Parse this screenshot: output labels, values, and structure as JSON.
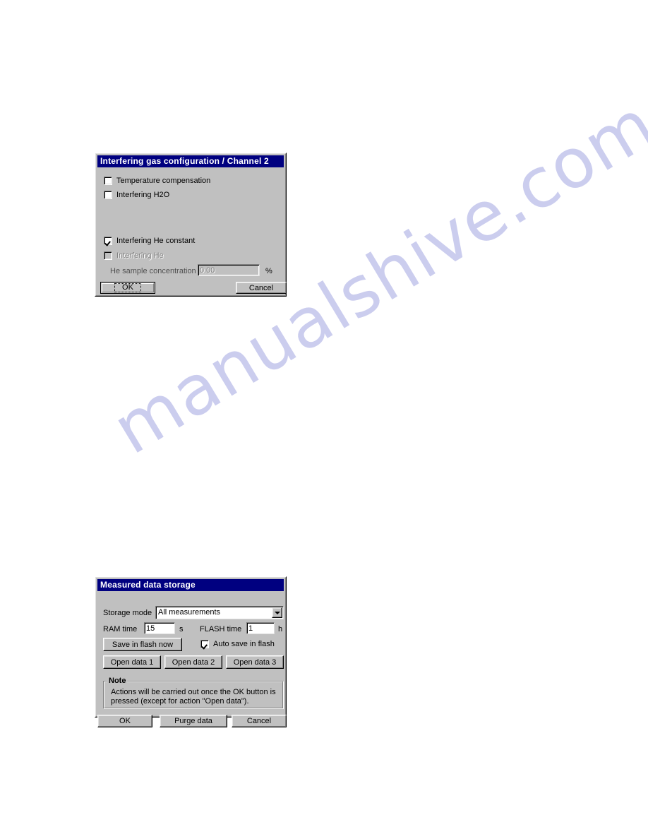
{
  "page": {
    "watermark": "manualshive.com",
    "watermark_color": "#c9cbee",
    "background_color": "#ffffff"
  },
  "dialog_interfering_gas": {
    "title": "Interfering gas configuration / Channel 2",
    "titlebar_color": "#000080",
    "face_color": "#c0c0c0",
    "checkboxes": [
      {
        "label": "Temperature compensation",
        "checked": false,
        "enabled": true
      },
      {
        "label": "Interfering H2O",
        "checked": false,
        "enabled": true
      },
      {
        "label": "Interfering He constant",
        "checked": true,
        "enabled": true
      },
      {
        "label": "Interfering He",
        "checked": false,
        "enabled": false
      }
    ],
    "he_concentration": {
      "label": "He sample concentration",
      "value": "0.00",
      "unit": "%",
      "enabled": false
    },
    "buttons": {
      "ok": "OK",
      "cancel": "Cancel"
    }
  },
  "dialog_measured_data_storage": {
    "title": "Measured data storage",
    "titlebar_color": "#000080",
    "face_color": "#c0c0c0",
    "storage_mode": {
      "label": "Storage mode",
      "value": "All measurements"
    },
    "ram_time": {
      "label": "RAM time",
      "value": "15",
      "unit": "s"
    },
    "flash_time": {
      "label": "FLASH time",
      "value": "1",
      "unit": "h"
    },
    "save_in_flash_now_button": "Save in flash now",
    "auto_save_checkbox": {
      "label": "Auto save in flash",
      "checked": true
    },
    "open_data_buttons": [
      "Open data 1",
      "Open data 2",
      "Open data 3"
    ],
    "note": {
      "title": "Note",
      "line1": "Actions will be carried out once the OK button is",
      "line2": "pressed (except for action \"Open data\")."
    },
    "buttons": {
      "ok": "OK",
      "purge": "Purge data",
      "cancel": "Cancel"
    }
  }
}
